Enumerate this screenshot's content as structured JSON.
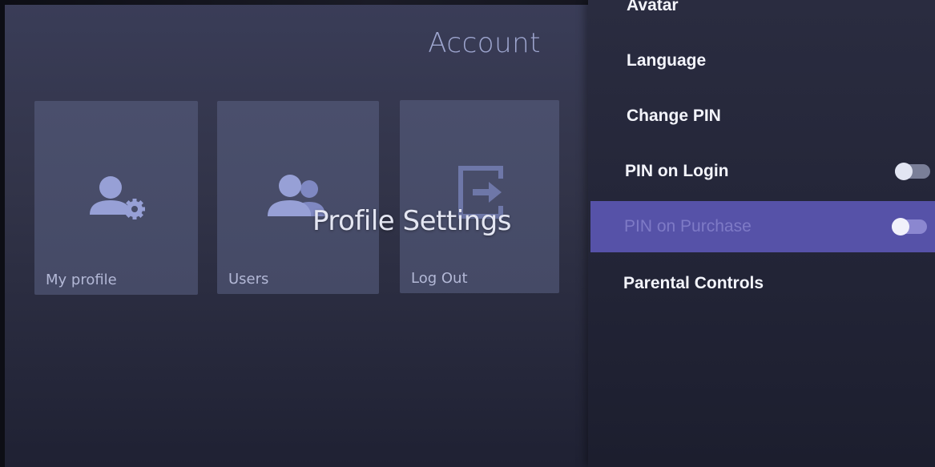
{
  "header": {
    "title": "Account"
  },
  "overlay": {
    "title": "Profile Settings"
  },
  "tiles": [
    {
      "label": "My profile",
      "icon": "user-settings-icon"
    },
    {
      "label": "Users",
      "icon": "users-icon"
    },
    {
      "label": "Log Out",
      "icon": "logout-icon"
    }
  ],
  "menu": {
    "items": [
      {
        "label": "Avatar"
      },
      {
        "label": "Language"
      },
      {
        "label": "Change PIN"
      },
      {
        "label": "PIN on Login",
        "toggle": "off"
      },
      {
        "label": "PIN on Purchase",
        "toggle": "off",
        "selected": true
      },
      {
        "label": "Parental Controls"
      }
    ]
  },
  "colors": {
    "accent": "#5652a8",
    "title": "#9ea6cf",
    "tile": "#4a4f6c",
    "text": "#f3f4fb"
  }
}
